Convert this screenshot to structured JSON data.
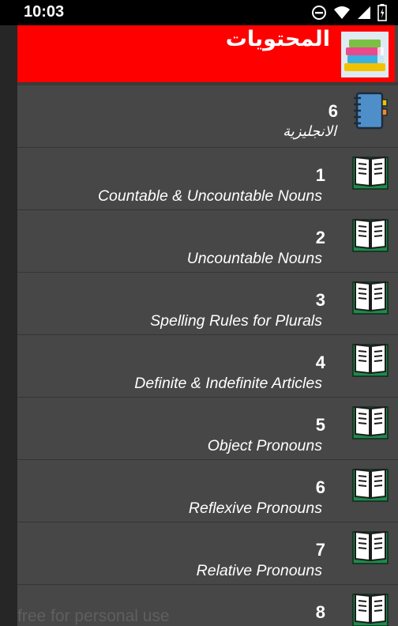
{
  "status_bar": {
    "time": "10:03"
  },
  "header": {
    "title": "المحتويات"
  },
  "category": {
    "count": "6",
    "label": "الانجليزية"
  },
  "items": [
    {
      "number": "1",
      "title": "Countable & Uncountable Nouns"
    },
    {
      "number": "2",
      "title": "Uncountable Nouns"
    },
    {
      "number": "3",
      "title": "Spelling Rules for Plurals"
    },
    {
      "number": "4",
      "title": "Definite & Indefinite Articles"
    },
    {
      "number": "5",
      "title": "Object Pronouns"
    },
    {
      "number": "6",
      "title": "Reflexive Pronouns"
    },
    {
      "number": "7",
      "title": "Relative Pronouns"
    },
    {
      "number": "8",
      "title": ""
    }
  ],
  "watermark": "free for personal use",
  "colors": {
    "header": "#ff0000",
    "panel": "#454545",
    "row": "#474747",
    "book_green": "#1f8a4c"
  }
}
